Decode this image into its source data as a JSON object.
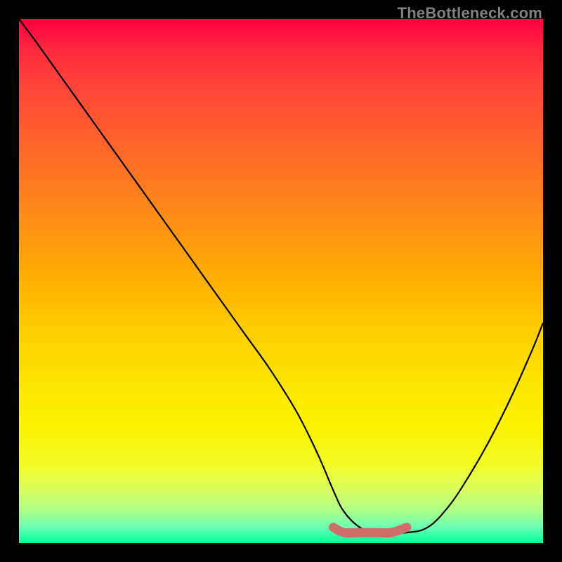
{
  "watermark": "TheBottleneck.com",
  "chart_data": {
    "type": "line",
    "title": "",
    "xlabel": "",
    "ylabel": "",
    "xlim": [
      0,
      100
    ],
    "ylim": [
      0,
      100
    ],
    "grid": false,
    "series": [
      {
        "name": "bottleneck-curve",
        "x": [
          0,
          3,
          8,
          13,
          18,
          23,
          28,
          33,
          38,
          43,
          48,
          53,
          57,
          60,
          62,
          65,
          68,
          71,
          74,
          78,
          82,
          86,
          90,
          94,
          98,
          100
        ],
        "values": [
          100,
          96,
          89,
          82,
          75,
          68,
          61,
          54,
          47,
          40,
          33,
          25,
          17,
          10,
          6,
          3,
          2,
          2,
          2,
          3,
          7,
          13,
          20,
          28,
          37,
          42
        ],
        "color": "#000000"
      },
      {
        "name": "optimal-range",
        "x": [
          60,
          62,
          65,
          68,
          71,
          74
        ],
        "values": [
          3,
          2,
          2,
          2,
          2,
          3
        ],
        "color": "#cf6d69"
      }
    ],
    "annotations": []
  }
}
